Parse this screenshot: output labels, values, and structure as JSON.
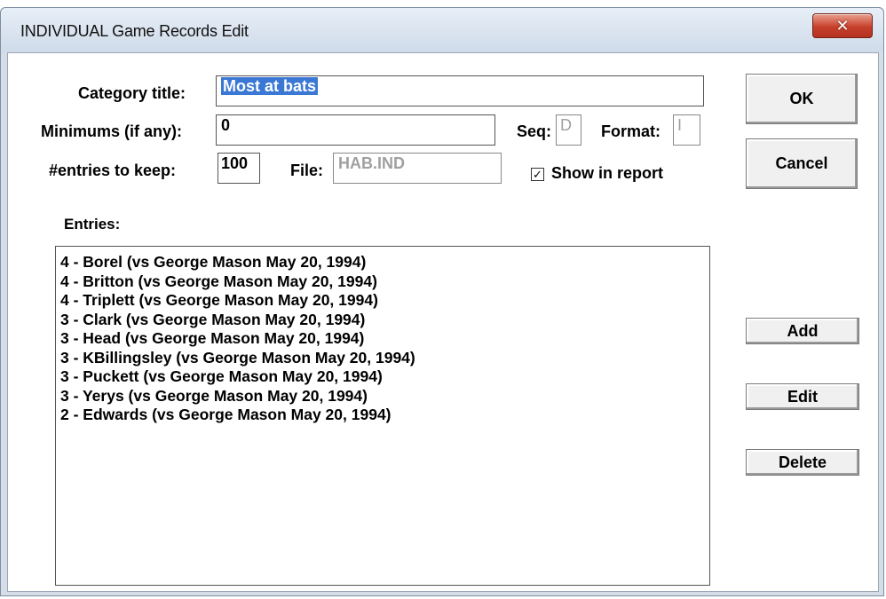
{
  "window": {
    "title": "INDIVIDUAL Game Records Edit",
    "close_glyph": "✕"
  },
  "form": {
    "category_title_label": "Category title:",
    "category_title_value": "Most at bats",
    "minimums_label": "Minimums (if any):",
    "minimums_value": "0",
    "seq_label": "Seq:",
    "seq_value": "D",
    "format_label": "Format:",
    "format_value": "I",
    "entries_keep_label": "#entries to keep:",
    "entries_keep_value": "100",
    "file_label": "File:",
    "file_value": "HAB.IND",
    "show_in_report_label": "Show in report",
    "show_in_report_checked": true,
    "entries_label": "Entries:"
  },
  "entries": [
    "4 - Borel (vs George Mason May 20, 1994)",
    "4 - Britton (vs George Mason May 20, 1994)",
    "4 - Triplett (vs George Mason May 20, 1994)",
    "3 - Clark (vs George Mason May 20, 1994)",
    "3 - Head (vs George Mason May 20, 1994)",
    "3 - KBillingsley (vs George Mason May 20, 1994)",
    "3 - Puckett (vs George Mason May 20, 1994)",
    "3 - Yerys (vs George Mason May 20, 1994)",
    "2 - Edwards (vs George Mason May 20, 1994)"
  ],
  "buttons": {
    "ok": "OK",
    "cancel": "Cancel",
    "add": "Add",
    "edit": "Edit",
    "delete": "Delete"
  },
  "colors": {
    "selection": "#3a78d4",
    "close_button": "#c7402b",
    "window_frame": "#d4dde8"
  }
}
